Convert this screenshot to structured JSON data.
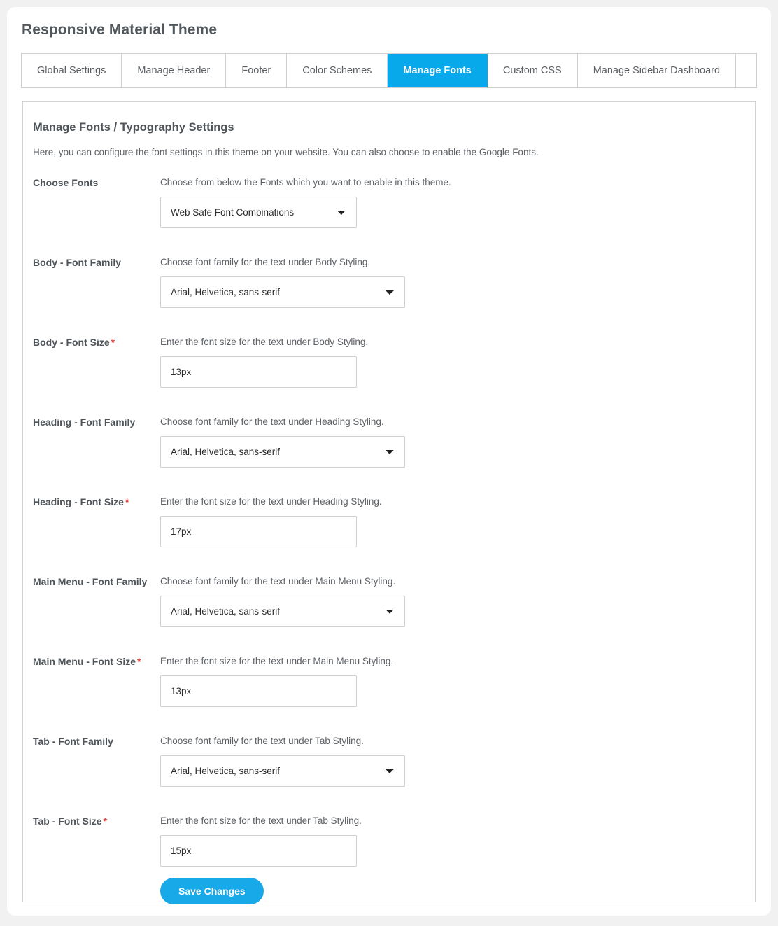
{
  "page": {
    "title": "Responsive Material Theme"
  },
  "tabs": [
    {
      "label": "Global Settings",
      "active": false
    },
    {
      "label": "Manage Header",
      "active": false
    },
    {
      "label": "Footer",
      "active": false
    },
    {
      "label": "Color Schemes",
      "active": false
    },
    {
      "label": "Manage Fonts",
      "active": true
    },
    {
      "label": "Custom CSS",
      "active": false
    },
    {
      "label": "Manage Sidebar Dashboard",
      "active": false
    }
  ],
  "panel": {
    "heading": "Manage Fonts / Typography Settings",
    "description": "Here, you can configure the font settings in this theme on your website. You can also choose to enable the Google Fonts."
  },
  "fields": {
    "choose_fonts": {
      "label": "Choose Fonts",
      "required": false,
      "description": "Choose from below the Fonts which you want to enable in this theme.",
      "type": "select",
      "value": "Web Safe Font Combinations"
    },
    "body_font_family": {
      "label": "Body - Font Family",
      "required": false,
      "description": "Choose font family for the text under Body Styling.",
      "type": "select",
      "value": "Arial, Helvetica, sans-serif"
    },
    "body_font_size": {
      "label": "Body - Font Size",
      "required": true,
      "description": "Enter the font size for the text under Body Styling.",
      "type": "text",
      "value": "13px"
    },
    "heading_font_family": {
      "label": "Heading - Font Family",
      "required": false,
      "description": "Choose font family for the text under Heading Styling.",
      "type": "select",
      "value": "Arial, Helvetica, sans-serif"
    },
    "heading_font_size": {
      "label": "Heading - Font Size",
      "required": true,
      "description": "Enter the font size for the text under Heading Styling.",
      "type": "text",
      "value": "17px"
    },
    "main_menu_font_family": {
      "label": "Main Menu - Font Family",
      "required": false,
      "description": "Choose font family for the text under Main Menu Styling.",
      "type": "select",
      "value": "Arial, Helvetica, sans-serif"
    },
    "main_menu_font_size": {
      "label": "Main Menu - Font Size",
      "required": true,
      "description": "Enter the font size for the text under Main Menu Styling.",
      "type": "text",
      "value": "13px"
    },
    "tab_font_family": {
      "label": "Tab - Font Family",
      "required": false,
      "description": "Choose font family for the text under Tab Styling.",
      "type": "select",
      "value": "Arial, Helvetica, sans-serif"
    },
    "tab_font_size": {
      "label": "Tab - Font Size",
      "required": true,
      "description": "Enter the font size for the text under Tab Styling.",
      "type": "text",
      "value": "15px"
    }
  },
  "actions": {
    "save_label": "Save Changes"
  },
  "required_marker": "*",
  "colors": {
    "accent": "#07a9eb",
    "button": "#17a9e8",
    "required": "#e03b3b",
    "page_background": "#f1f1f1",
    "panel_border": "#d2d2d2"
  }
}
